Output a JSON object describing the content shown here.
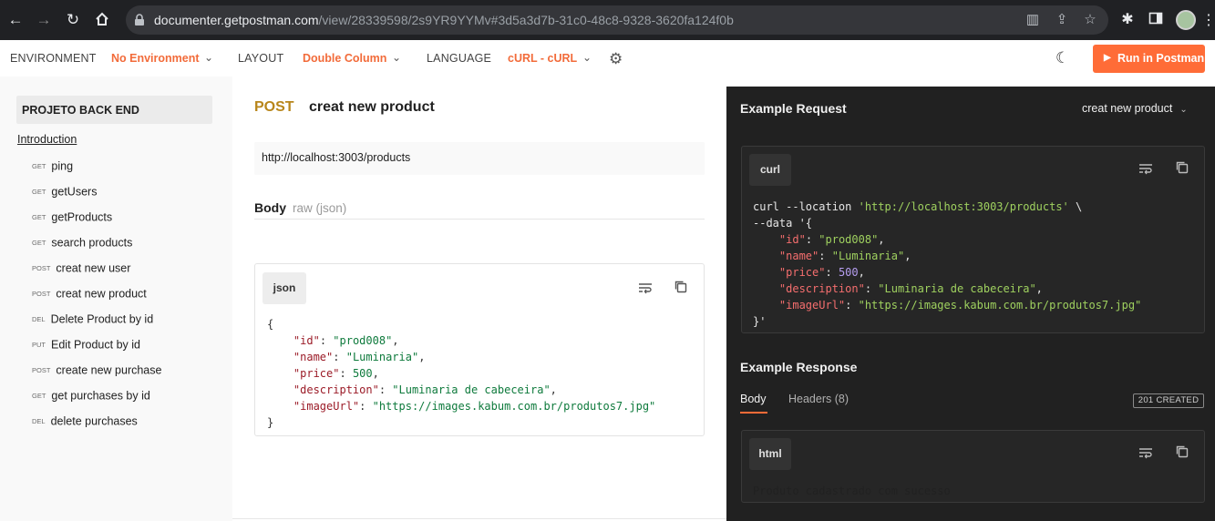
{
  "browser": {
    "url_host": "documenter.getpostman.com",
    "url_path": "/view/28339598/2s9YR9YYMv#3d5a3d7b-31c0-48c8-9328-3620fa124f0b"
  },
  "topbar": {
    "environment_label": "ENVIRONMENT",
    "environment_value": "No Environment",
    "layout_label": "LAYOUT",
    "layout_value": "Double Column",
    "language_label": "LANGUAGE",
    "language_value": "cURL - cURL",
    "run_button": "Run in Postman"
  },
  "sidebar": {
    "collection_title": "PROJETO BACK END",
    "intro_link": "Introduction",
    "items": [
      {
        "method": "GET",
        "name": "ping"
      },
      {
        "method": "GET",
        "name": "getUsers"
      },
      {
        "method": "GET",
        "name": "getProducts"
      },
      {
        "method": "GET",
        "name": "search products"
      },
      {
        "method": "POST",
        "name": "creat new user"
      },
      {
        "method": "POST",
        "name": "creat new product"
      },
      {
        "method": "DEL",
        "name": "Delete Product by id"
      },
      {
        "method": "PUT",
        "name": "Edit Product by id"
      },
      {
        "method": "POST",
        "name": "create new purchase"
      },
      {
        "method": "GET",
        "name": "get purchases by id"
      },
      {
        "method": "DEL",
        "name": "delete purchases"
      }
    ]
  },
  "request": {
    "method": "POST",
    "title": "creat new product",
    "url": "http://localhost:3003/products",
    "body_label": "Body",
    "body_type": "raw (json)",
    "body_lang": "json",
    "body_json": {
      "open": "{",
      "close": "}",
      "fields": [
        {
          "key": "\"id\"",
          "value": "\"prod008\"",
          "type": "s"
        },
        {
          "key": "\"name\"",
          "value": "\"Luminaria\"",
          "type": "s"
        },
        {
          "key": "\"price\"",
          "value": "500",
          "type": "n"
        },
        {
          "key": "\"description\"",
          "value": "\"Luminaria de cabeceira\"",
          "type": "s"
        },
        {
          "key": "\"imageUrl\"",
          "value": "\"https://images.kabum.com.br/produtos7.jpg\"",
          "type": "s"
        }
      ]
    }
  },
  "example_request": {
    "title": "Example Request",
    "selected_example": "creat new product",
    "lang": "curl",
    "curl_cmd": "curl --location ",
    "curl_url": "'http://localhost:3003/products'",
    "curl_cont": " \\",
    "data_flag": "--data '",
    "close": "}'"
  },
  "example_response": {
    "title": "Example Response",
    "tabs": [
      "Body",
      "Headers (8)"
    ],
    "status": "201 CREATED",
    "lang": "html",
    "body": "Produto cadastrado com sucesso"
  },
  "colors": {
    "accent": "#ff6c37",
    "post_method": "#b8861b",
    "dark_panel": "#212121"
  }
}
